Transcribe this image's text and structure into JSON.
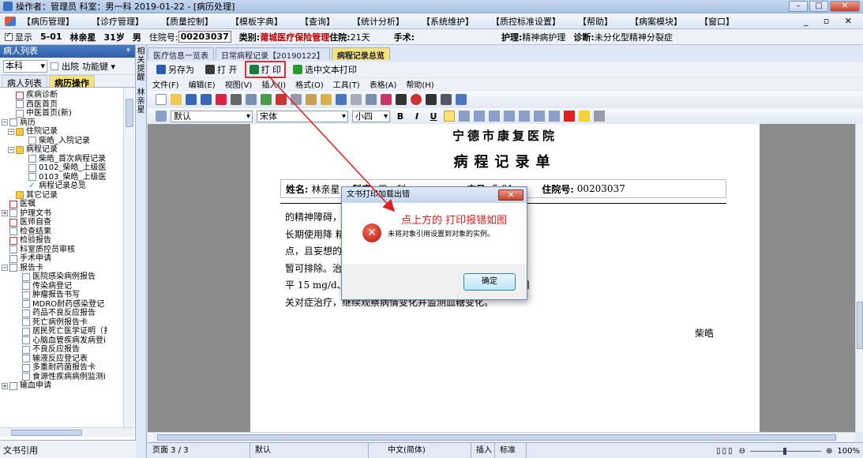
{
  "window": {
    "title": "操作者：管理员  科室：男一科  2019-01-22 - [病历处理]",
    "controls": [
      "–",
      "□",
      "✕"
    ]
  },
  "menubar": {
    "items": [
      "【病历管理】",
      "【诊疗管理】",
      "【质量控制】",
      "【模板字典】",
      "【查询】",
      "【统计分析】",
      "【系统维护】",
      "【质控标准设置】",
      "【帮助】",
      "【病案模块】",
      "【窗口】"
    ],
    "mdi_controls": "_ ▫ ✕"
  },
  "infobar": {
    "show_label": "显示",
    "bed": "5-01",
    "name": "林亲星",
    "age": "31岁",
    "sex": "男",
    "admission_label": "住院号:",
    "admission_no": "00203037",
    "category_label": "类别:",
    "category": "莆城医疗保险管理",
    "days_label": "住院:",
    "days": "21天",
    "surgery_label": "手术:",
    "nursing_label": "护理:",
    "nursing": "精神病护理",
    "diagnosis_label": "诊断:",
    "diagnosis": "未分化型精神分裂症"
  },
  "leftpanel": {
    "title": "病人列表",
    "pin": "ᵠ",
    "dept_select": "本科",
    "discharged_label": "出院",
    "function_key": "功能键 ▾",
    "tabs": [
      "病人列表",
      "病历操作"
    ],
    "tree": [
      {
        "depth": 1,
        "toggle": "",
        "icon": "red",
        "label": "疾病诊断"
      },
      {
        "depth": 1,
        "toggle": "",
        "icon": "doc",
        "label": "西医首页"
      },
      {
        "depth": 1,
        "toggle": "",
        "icon": "doc",
        "label": "中医首页(新)"
      },
      {
        "depth": 0,
        "toggle": "−",
        "icon": "doc",
        "label": "病历"
      },
      {
        "depth": 1,
        "toggle": "−",
        "icon": "folder",
        "label": "住院记录"
      },
      {
        "depth": 3,
        "toggle": "",
        "icon": "doc",
        "label": "柴皓_入院记录"
      },
      {
        "depth": 1,
        "toggle": "−",
        "icon": "folder",
        "label": "病程记录"
      },
      {
        "depth": 3,
        "toggle": "",
        "icon": "doc",
        "label": "柴皓_首次病程记录"
      },
      {
        "depth": 3,
        "toggle": "",
        "icon": "doc",
        "label": "0102_柴皓_上级医"
      },
      {
        "depth": 3,
        "toggle": "",
        "icon": "doc",
        "label": "0103_柴皓_上级医"
      },
      {
        "depth": 3,
        "toggle": "",
        "icon": "check",
        "label": "病程记录总览"
      },
      {
        "depth": 1,
        "toggle": "",
        "icon": "folder",
        "label": "其它记录"
      },
      {
        "depth": 0,
        "toggle": "",
        "icon": "red",
        "label": "医嘱"
      },
      {
        "depth": 0,
        "toggle": "+",
        "icon": "doc",
        "label": "护理文书"
      },
      {
        "depth": 0,
        "toggle": "",
        "icon": "red",
        "label": "医师自查"
      },
      {
        "depth": 0,
        "toggle": "",
        "icon": "doc",
        "label": "检查结果"
      },
      {
        "depth": 0,
        "toggle": "",
        "icon": "red",
        "label": "检验报告"
      },
      {
        "depth": 0,
        "toggle": "",
        "icon": "doc",
        "label": "科室质控员审核"
      },
      {
        "depth": 0,
        "toggle": "",
        "icon": "doc",
        "label": "手术申请"
      },
      {
        "depth": 0,
        "toggle": "−",
        "icon": "doc",
        "label": "报告卡"
      },
      {
        "depth": 2,
        "toggle": "",
        "icon": "doc",
        "label": "医院感染病例报告"
      },
      {
        "depth": 2,
        "toggle": "",
        "icon": "doc",
        "label": "传染病登记"
      },
      {
        "depth": 2,
        "toggle": "",
        "icon": "doc",
        "label": "肿瘤报告书写"
      },
      {
        "depth": 2,
        "toggle": "",
        "icon": "doc",
        "label": "MDRO耐药感染登记"
      },
      {
        "depth": 2,
        "toggle": "",
        "icon": "doc",
        "label": "药品不良反应报告"
      },
      {
        "depth": 2,
        "toggle": "",
        "icon": "doc",
        "label": "死亡病例报告卡"
      },
      {
        "depth": 2,
        "toggle": "",
        "icon": "doc",
        "label": "居民死亡医学证明（扌"
      },
      {
        "depth": 2,
        "toggle": "",
        "icon": "doc",
        "label": "心脑血管疾病发病登i"
      },
      {
        "depth": 2,
        "toggle": "",
        "icon": "doc",
        "label": "不良反应报告"
      },
      {
        "depth": 2,
        "toggle": "",
        "icon": "doc",
        "label": "输液反应登记表"
      },
      {
        "depth": 2,
        "toggle": "",
        "icon": "doc",
        "label": "多重耐药菌报告卡"
      },
      {
        "depth": 2,
        "toggle": "",
        "icon": "doc",
        "label": "食源性疾病病例监测i"
      },
      {
        "depth": 0,
        "toggle": "+",
        "icon": "doc",
        "label": "输血申请"
      }
    ],
    "footer": "文书引用"
  },
  "sidestrip": {
    "top": "相关提醒",
    "bottom": "林亲星"
  },
  "doctabs": [
    "医疗信息一览表",
    "日常病程记录【20190122】",
    "病程记录总览"
  ],
  "toolbar": {
    "save_as": "另存为",
    "open": "打 开",
    "print": "打 印",
    "print_selected": "选中文本打印"
  },
  "word_menu": [
    "文件(F)",
    "编辑(E)",
    "视图(V)",
    "插入(I)",
    "格式(O)",
    "工具(T)",
    "表格(A)",
    "帮助(H)"
  ],
  "format": {
    "style": "默认",
    "font": "宋体",
    "size": "小四",
    "buttons": [
      "B",
      "I",
      "U"
    ]
  },
  "document": {
    "hospital": "宁德市康复医院",
    "record_title": "病程记录单",
    "name_label": "姓名:",
    "name": "林亲星",
    "dept_label": "科室:",
    "dept": "男一科",
    "bed_label": "床号:",
    "bed": "5-01",
    "admission_label": "住院号:",
    "admission": "00203037",
    "paragraph": [
      "的精神障碍，                                            诊断；住我院期间有发现患有糖尿病，目前",
      "长期使用降                                            精神障碍  本病主要以系统的妄想为主要特",
      "点，且妄想的                                        无明显妄想，存言语性幻听，与本病不符，",
      "暂可排除。治                                        关辅助检查并监测血糖变化。目前用药奥氮",
      "平 15 mg/d、                                       合脑电治疗、行为矫正治疗、有氧训练等相",
      "关对症治疗，继续观察病情变化并监测血糖变化。"
    ],
    "signer": "柴皓"
  },
  "dialog": {
    "title": "文书打印加载出错",
    "close": "✕",
    "message": "未将对象引用设置到对象的实例。",
    "ok": "确定"
  },
  "annotation": "点上方的 打印报错如图",
  "statusbar": {
    "page": "页面  3 / 3",
    "style": "默认",
    "lang": "中文(简体)",
    "insert": "插入",
    "mode": "标准",
    "zoom": "100%"
  },
  "colors": {
    "annotation": "#e02020",
    "highlight_box": "#e03030",
    "category_text": "#c00000"
  }
}
